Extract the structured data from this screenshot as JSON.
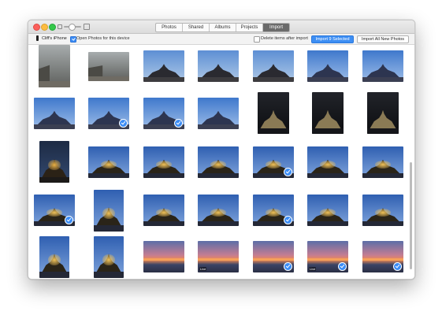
{
  "titlebar": {
    "tabs": [
      {
        "label": "Photos"
      },
      {
        "label": "Shared"
      },
      {
        "label": "Albums"
      },
      {
        "label": "Projects"
      },
      {
        "label": "Import",
        "active": true
      }
    ]
  },
  "toolbar": {
    "device_name": "Cliff's iPhone",
    "open_photos_label": "Open Photos for this device",
    "open_photos_checked": true,
    "delete_items_label": "Delete items after import",
    "delete_items_checked": false,
    "import_selected_label": "Import 9 Selected",
    "import_all_label": "Import All New Photos"
  },
  "photos": [
    {
      "kind": "street",
      "selected": false
    },
    {
      "kind": "street",
      "selected": false
    },
    {
      "kind": "abbey-dusk",
      "selected": false
    },
    {
      "kind": "abbey-dusk",
      "selected": false
    },
    {
      "kind": "abbey-dusk",
      "selected": false
    },
    {
      "kind": "abbey-blue",
      "selected": false
    },
    {
      "kind": "abbey-blue",
      "selected": false
    },
    {
      "kind": "abbey-blue",
      "selected": false
    },
    {
      "kind": "abbey-blue",
      "selected": true
    },
    {
      "kind": "abbey-blue",
      "selected": true
    },
    {
      "kind": "abbey-blue",
      "selected": false
    },
    {
      "kind": "dark-portrait",
      "selected": false
    },
    {
      "kind": "dark-portrait",
      "selected": false
    },
    {
      "kind": "dark-portrait",
      "selected": false
    },
    {
      "kind": "abbey-night",
      "selected": false
    },
    {
      "kind": "abbey-lit",
      "selected": false
    },
    {
      "kind": "abbey-lit",
      "selected": false
    },
    {
      "kind": "abbey-lit",
      "selected": false
    },
    {
      "kind": "abbey-lit",
      "selected": true
    },
    {
      "kind": "abbey-lit",
      "selected": false
    },
    {
      "kind": "abbey-lit",
      "selected": false
    },
    {
      "kind": "abbey-lit",
      "selected": true
    },
    {
      "kind": "abbey-lit",
      "selected": false
    },
    {
      "kind": "abbey-lit",
      "selected": false
    },
    {
      "kind": "abbey-lit",
      "selected": false
    },
    {
      "kind": "abbey-lit",
      "selected": true
    },
    {
      "kind": "abbey-lit",
      "selected": false
    },
    {
      "kind": "abbey-lit",
      "selected": false
    },
    {
      "kind": "abbey-lit",
      "selected": false
    },
    {
      "kind": "abbey-lit",
      "selected": false
    },
    {
      "kind": "sunset",
      "selected": false
    },
    {
      "kind": "sunset",
      "selected": false,
      "badge": "Live"
    },
    {
      "kind": "sunset",
      "selected": true
    },
    {
      "kind": "sunset",
      "selected": true,
      "badge": "Live"
    },
    {
      "kind": "sunset",
      "selected": true
    }
  ],
  "colors": {
    "accent": "#3b8cf5",
    "tab_active": "#6b6b6b"
  }
}
